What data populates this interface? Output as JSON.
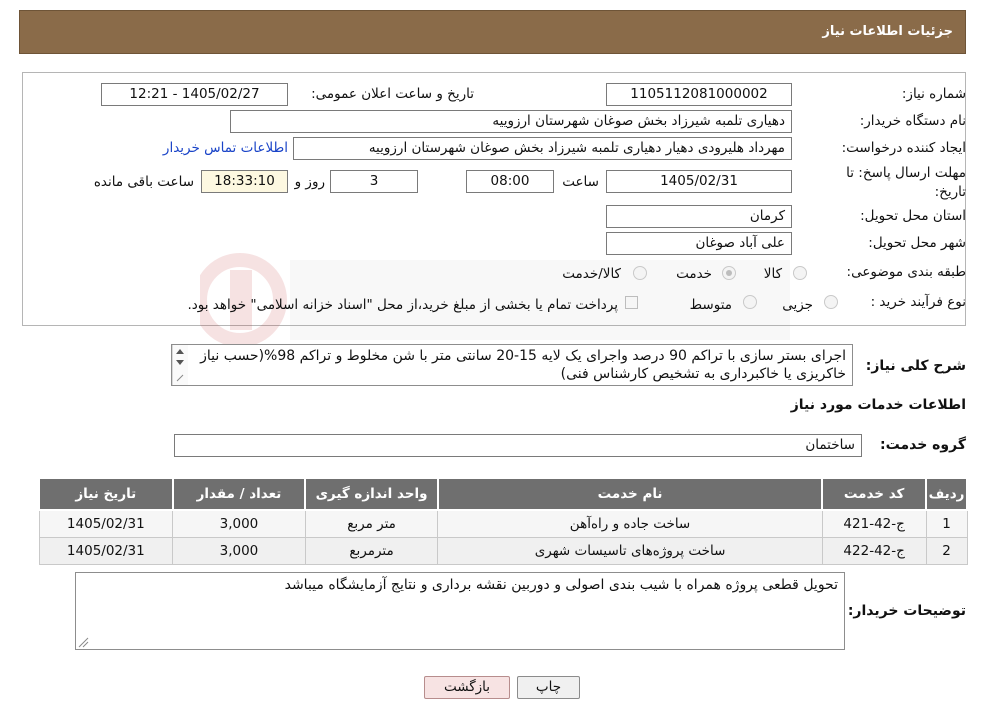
{
  "header": {
    "title": "جزئیات اطلاعات نیاز"
  },
  "form": {
    "need_number_label": "شماره نیاز:",
    "need_number": "1105112081000002",
    "announce_label": "تاریخ و ساعت اعلان عمومی:",
    "announce_value": "1405/02/27 - 12:21",
    "buyer_org_label": "نام دستگاه خریدار:",
    "buyer_org": "دهیاری تلمبه شیرزاد بخش صوغان شهرستان ارزوییه",
    "creator_label": "ایجاد کننده درخواست:",
    "creator": "مهرداد هلیرودی دهیار دهیاری تلمبه شیرزاد بخش صوغان شهرستان ارزوییه",
    "contact_link": "اطلاعات تماس خریدار",
    "deadline_label_1": "مهلت ارسال پاسخ: تا",
    "deadline_label_2": "تاریخ:",
    "deadline_date": "1405/02/31",
    "time_label": "ساعت",
    "deadline_time": "08:00",
    "days_value": "3",
    "days_label": "روز و",
    "remaining_time": "18:33:10",
    "remaining_label": "ساعت باقی مانده",
    "province_label": "استان محل تحویل:",
    "province": "کرمان",
    "city_label": "شهر محل تحویل:",
    "city": "علی آباد صوغان",
    "category_label": "طبقه بندی موضوعی:",
    "category_options": [
      "کالا",
      "خدمت",
      "کالا/خدمت"
    ],
    "category_selected": "خدمت",
    "purchase_label": "نوع فرآیند خرید :",
    "purchase_options": [
      "جزیی",
      "متوسط"
    ],
    "payment_note": "پرداخت تمام یا بخشی از مبلغ خرید،از محل \"اسناد خزانه اسلامی\" خواهد بود."
  },
  "description": {
    "label": "شرح کلی نیاز:",
    "text": "اجرای بستر سازی با تراکم 90 درصد واجرای یک لایه 15-20 سانتی متر با شن مخلوط و تراکم 98%(حسب نیاز خاکریزی یا خاکبرداری به تشخیص کارشناس فنی)"
  },
  "services": {
    "section_title": "اطلاعات خدمات مورد نیاز",
    "group_label": "گروه خدمت:",
    "group_value": "ساختمان",
    "columns": [
      "ردیف",
      "کد خدمت",
      "نام خدمت",
      "واحد اندازه گیری",
      "تعداد / مقدار",
      "تاریخ نیاز"
    ],
    "rows": [
      {
        "idx": "1",
        "code": "ج-42-421",
        "name": "ساخت جاده و راه‌آهن",
        "unit": "متر مربع",
        "qty": "3,000",
        "date": "1405/02/31"
      },
      {
        "idx": "2",
        "code": "ج-42-422",
        "name": "ساخت پروژه‌های تاسیسات شهری",
        "unit": "مترمربع",
        "qty": "3,000",
        "date": "1405/02/31"
      }
    ]
  },
  "notes": {
    "label": "توضیحات خریدار:",
    "text": "تحویل قطعی پروژه همراه با شیب بندی اصولی و دوربین نقشه برداری و نتایج آزمایشگاه میباشد"
  },
  "buttons": {
    "print": "چاپ",
    "back": "بازگشت"
  },
  "colors": {
    "header_bg": "#8a6b49",
    "table_header": "#6f6f6f",
    "link": "#1a44c8"
  }
}
